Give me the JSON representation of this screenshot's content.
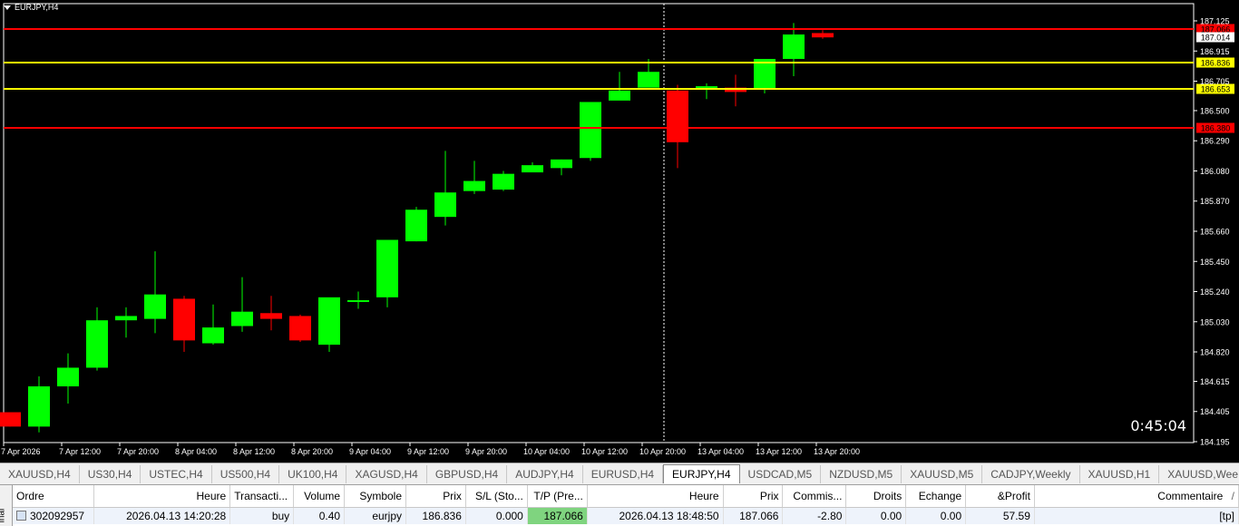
{
  "chart": {
    "symbol_label": "EURJPY,H4",
    "timer": "0:45:04",
    "colors": {
      "bull": "#00ff00",
      "bear": "#ff0000",
      "background": "#000000",
      "text": "#ffffff",
      "tp_sl": "#ff0000",
      "entry": "#ffff00"
    }
  },
  "chart_data": {
    "type": "candlestick",
    "ylim": [
      184.195,
      187.2
    ],
    "y_ticks": [
      "187.125",
      "186.915",
      "186.705",
      "186.500",
      "186.290",
      "186.080",
      "185.870",
      "185.660",
      "185.450",
      "185.240",
      "185.030",
      "184.820",
      "184.615",
      "184.405",
      "184.195"
    ],
    "x_ticks": [
      "7 Apr 2026",
      "7 Apr 12:00",
      "7 Apr 20:00",
      "8 Apr 04:00",
      "8 Apr 12:00",
      "8 Apr 20:00",
      "9 Apr 04:00",
      "9 Apr 12:00",
      "9 Apr 20:00",
      "10 Apr 04:00",
      "10 Apr 12:00",
      "10 Apr 20:00",
      "13 Apr 04:00",
      "13 Apr 12:00",
      "13 Apr 20:00"
    ],
    "x_tick_bar_index": [
      0,
      2,
      4,
      6,
      8,
      10,
      12,
      14,
      16,
      18,
      20,
      22,
      24,
      26,
      28
    ],
    "candles": [
      {
        "o": 184.4,
        "h": 184.38,
        "l": 184.3,
        "c": 184.3
      },
      {
        "o": 184.3,
        "h": 184.65,
        "l": 184.26,
        "c": 184.58
      },
      {
        "o": 184.58,
        "h": 184.81,
        "l": 184.46,
        "c": 184.71
      },
      {
        "o": 184.71,
        "h": 185.13,
        "l": 184.69,
        "c": 185.04
      },
      {
        "o": 185.04,
        "h": 185.13,
        "l": 184.92,
        "c": 185.07
      },
      {
        "o": 185.05,
        "h": 185.52,
        "l": 184.95,
        "c": 185.22
      },
      {
        "o": 185.19,
        "h": 185.21,
        "l": 184.82,
        "c": 184.9
      },
      {
        "o": 184.88,
        "h": 185.15,
        "l": 184.87,
        "c": 184.99
      },
      {
        "o": 185.0,
        "h": 185.34,
        "l": 184.96,
        "c": 185.1
      },
      {
        "o": 185.09,
        "h": 185.21,
        "l": 184.97,
        "c": 185.05
      },
      {
        "o": 185.07,
        "h": 185.08,
        "l": 184.89,
        "c": 184.9
      },
      {
        "o": 184.87,
        "h": 185.18,
        "l": 184.82,
        "c": 185.2
      },
      {
        "o": 185.17,
        "h": 185.24,
        "l": 185.12,
        "c": 185.18
      },
      {
        "o": 185.2,
        "h": 185.6,
        "l": 185.13,
        "c": 185.6
      },
      {
        "o": 185.59,
        "h": 185.83,
        "l": 185.59,
        "c": 185.81
      },
      {
        "o": 185.76,
        "h": 186.22,
        "l": 185.7,
        "c": 185.93
      },
      {
        "o": 185.94,
        "h": 186.15,
        "l": 185.92,
        "c": 186.01
      },
      {
        "o": 185.95,
        "h": 186.08,
        "l": 185.94,
        "c": 186.06
      },
      {
        "o": 186.07,
        "h": 186.14,
        "l": 186.08,
        "c": 186.12
      },
      {
        "o": 186.1,
        "h": 186.16,
        "l": 186.05,
        "c": 186.16
      },
      {
        "o": 186.17,
        "h": 186.56,
        "l": 186.15,
        "c": 186.56
      },
      {
        "o": 186.57,
        "h": 186.77,
        "l": 186.58,
        "c": 186.64
      },
      {
        "o": 186.66,
        "h": 186.86,
        "l": 186.7,
        "c": 186.77
      },
      {
        "o": 186.64,
        "h": 186.68,
        "l": 186.1,
        "c": 186.28
      },
      {
        "o": 186.66,
        "h": 186.69,
        "l": 186.58,
        "c": 186.67
      },
      {
        "o": 186.66,
        "h": 186.75,
        "l": 186.53,
        "c": 186.63
      },
      {
        "o": 186.65,
        "h": 186.74,
        "l": 186.62,
        "c": 186.86
      },
      {
        "o": 186.86,
        "h": 187.11,
        "l": 186.74,
        "c": 187.03
      },
      {
        "o": 187.04,
        "h": 187.06,
        "l": 187.0,
        "c": 187.01
      }
    ],
    "levels": [
      {
        "price": 187.066,
        "label": "187.066",
        "color": "#ff0000",
        "kind": "tp"
      },
      {
        "price": 186.836,
        "label": "186.836",
        "color": "#ffff00",
        "kind": "entry"
      },
      {
        "price": 186.653,
        "label": "186.653",
        "color": "#ffff00",
        "kind": "level"
      },
      {
        "price": 186.38,
        "label": "186.380",
        "color": "#ff0000",
        "kind": "sl"
      }
    ],
    "current_price": {
      "price": 187.014,
      "label": "187.014"
    },
    "crosshair_bar_index": 22.5
  },
  "tabs": [
    {
      "label": "XAUUSD,H4",
      "active": false
    },
    {
      "label": "US30,H4",
      "active": false
    },
    {
      "label": "USTEC,H4",
      "active": false
    },
    {
      "label": "US500,H4",
      "active": false
    },
    {
      "label": "UK100,H4",
      "active": false
    },
    {
      "label": "XAGUSD,H4",
      "active": false
    },
    {
      "label": "GBPUSD,H4",
      "active": false
    },
    {
      "label": "AUDJPY,H4",
      "active": false
    },
    {
      "label": "EURUSD,H4",
      "active": false
    },
    {
      "label": "EURJPY,H4",
      "active": true
    },
    {
      "label": "USDCAD,M5",
      "active": false
    },
    {
      "label": "NZDUSD,M5",
      "active": false
    },
    {
      "label": "XAUUSD,M5",
      "active": false
    },
    {
      "label": "CADJPY,Weekly",
      "active": false
    },
    {
      "label": "XAUUSD,H1",
      "active": false
    },
    {
      "label": "XAUUSD,Wee",
      "active": false
    }
  ],
  "terminal": {
    "side_label": "inal",
    "headers": [
      "Ordre",
      "Heure",
      "Transacti...",
      "Volume",
      "Symbole",
      "Prix",
      "S/L (Sto...",
      "T/P (Pre...",
      "Heure",
      "Prix",
      "Commis...",
      "Droits",
      "Echange",
      "&Profit",
      "Commentaire"
    ],
    "sort_icon": "/",
    "row": {
      "ordre": "302092957",
      "heure": "2026.04.13 14:20:28",
      "transaction": "buy",
      "volume": "0.40",
      "symbole": "eurjpy",
      "prix": "186.836",
      "sl": "0.000",
      "tp": "187.066",
      "heure2": "2026.04.13 18:48:50",
      "prix2": "187.066",
      "commission": "-2.80",
      "droits": "0.00",
      "echange": "0.00",
      "profit": "57.59",
      "commentaire": "[tp]"
    }
  }
}
